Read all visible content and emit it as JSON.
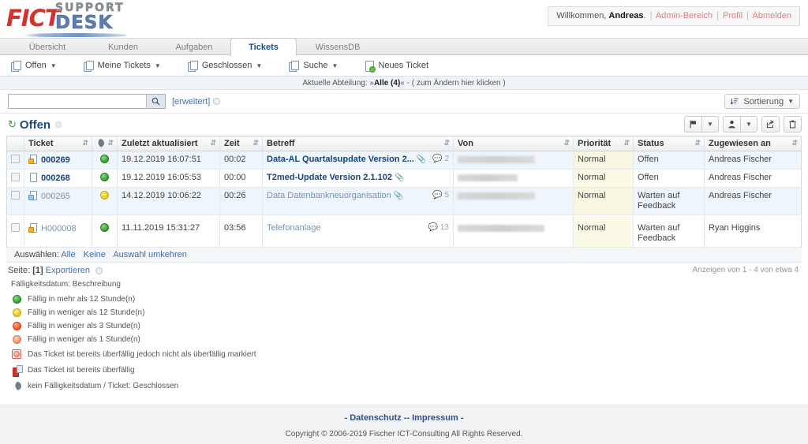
{
  "header": {
    "logo": {
      "part1": "FICT",
      "part2": "SUPPORT",
      "part3": "DESK"
    },
    "welcome_prefix": "Willkommen,",
    "welcome_user": "Andreas",
    "welcome_suffix": ".",
    "links": [
      "Admin-Bereich",
      "Profil",
      "Abmelden"
    ]
  },
  "tabs": [
    {
      "label": "Übersicht",
      "active": false
    },
    {
      "label": "Kunden",
      "active": false
    },
    {
      "label": "Aufgaben",
      "active": false
    },
    {
      "label": "Tickets",
      "active": true
    },
    {
      "label": "WissensDB",
      "active": false
    }
  ],
  "subnav": [
    {
      "label": "Offen",
      "icon": "pages-icon",
      "caret": true
    },
    {
      "label": "Meine Tickets",
      "icon": "pages-icon",
      "caret": true
    },
    {
      "label": "Geschlossen",
      "icon": "pages-icon",
      "caret": true
    },
    {
      "label": "Suche",
      "icon": "pages-icon",
      "caret": true
    },
    {
      "label": "Neues Ticket",
      "icon": "new-document-icon",
      "caret": false
    }
  ],
  "department_bar": {
    "label": "Aktuelle Abteilung:",
    "open_quote": "»",
    "value": "Alle (4)",
    "close_quote": "«",
    "dash": "-",
    "hint": "( zum Ändern hier klicken )"
  },
  "search": {
    "value": "",
    "placeholder": "",
    "advanced_label": "[erweitert]",
    "sort_label": "Sortierung"
  },
  "list": {
    "title": "Offen",
    "refresh_icon": "refresh-icon",
    "actions": [
      {
        "name": "flag-button",
        "icon": "flag-icon",
        "has_dropdown": true
      },
      {
        "name": "assign-user-button",
        "icon": "user-icon",
        "has_dropdown": true
      },
      {
        "name": "forward-button",
        "icon": "forward-icon",
        "has_dropdown": false
      },
      {
        "name": "delete-button",
        "icon": "trash-icon",
        "has_dropdown": false
      }
    ]
  },
  "table": {
    "columns": [
      {
        "label": "",
        "key": "checkbox",
        "sortable": false
      },
      {
        "label": "Ticket",
        "key": "ticket",
        "sortable": true
      },
      {
        "label": "",
        "key": "due",
        "sortable": true,
        "icon": "moon-icon"
      },
      {
        "label": "Zuletzt aktualisiert",
        "key": "updated",
        "sortable": true
      },
      {
        "label": "Zeit",
        "key": "time",
        "sortable": true
      },
      {
        "label": "Betreff",
        "key": "subject",
        "sortable": true
      },
      {
        "label": "Von",
        "key": "from",
        "sortable": true
      },
      {
        "label": "Priorität",
        "key": "priority",
        "sortable": true
      },
      {
        "label": "Status",
        "key": "status",
        "sortable": true
      },
      {
        "label": "Zugewiesen an",
        "key": "assigned",
        "sortable": true
      }
    ],
    "rows": [
      {
        "ticket": "000269",
        "ticket_icon": "ticket-locked-icon",
        "bold": true,
        "due_color": "green",
        "updated": "19.12.2019 16:07:51",
        "time": "00:02",
        "subject": "Data-AL Quartalsupdate Version 2...",
        "has_attachment": true,
        "comments": "2",
        "from_redacted_width": 98,
        "priority": "Normal",
        "status": "Offen",
        "assigned": "Andreas Fischer"
      },
      {
        "ticket": "000268",
        "ticket_icon": "ticket-document-icon",
        "bold": true,
        "due_color": "green",
        "updated": "19.12.2019 16:05:53",
        "time": "00:00",
        "subject": "T2med-Update Version 2.1.102",
        "has_attachment": true,
        "comments": "",
        "from_redacted_width": 76,
        "priority": "Normal",
        "status": "Offen",
        "assigned": "Andreas Fischer"
      },
      {
        "ticket": "000265",
        "ticket_icon": "ticket-draft-icon",
        "bold": false,
        "due_color": "yellow",
        "updated": "14.12.2019 10:06:22",
        "time": "00:26",
        "subject": "Data Datenbankneuorganisation",
        "has_attachment": true,
        "comments": "5",
        "from_redacted_width": 98,
        "priority": "Normal",
        "status": "Warten auf Feedback",
        "assigned": "Andreas Fischer"
      },
      {
        "ticket": "H000008",
        "ticket_icon": "ticket-locked-icon",
        "bold": false,
        "due_color": "green",
        "updated": "11.11.2019 15:31:27",
        "time": "03:56",
        "subject": "Telefonanlage",
        "has_attachment": false,
        "comments": "13",
        "from_redacted_width": 110,
        "priority": "Normal",
        "status": "Warten auf Feedback",
        "assigned": "Ryan Higgins"
      }
    ]
  },
  "selection": {
    "label": "Auswählen:",
    "options": [
      "Alle",
      "Keine",
      "Auswahl umkehren"
    ]
  },
  "pagination": {
    "page_label": "Seite:",
    "current_page": "[1]",
    "export_label": "Exportieren",
    "showing": "Anzeigen von  1 - 4 von etwa 4"
  },
  "legend": {
    "title": "Fälligkeitsdatum: Beschreibung",
    "items": [
      {
        "icon": "green-dot-icon",
        "text": "Fällig in mehr als 12 Stunde(n)"
      },
      {
        "icon": "yellow-dot-icon",
        "text": "Fällig in weniger als 12 Stunde(n)"
      },
      {
        "icon": "orange-dot-icon",
        "text": "Fällig in weniger als 3 Stunde(n)"
      },
      {
        "icon": "light-orange-dot-icon",
        "text": "Fällig in weniger als 1 Stunde(n)"
      },
      {
        "icon": "boxed-overdue-icon",
        "text": "Das Ticket ist bereits überfällig jedoch nicht als überfällig markiert"
      },
      {
        "icon": "fire-extinguisher-icon",
        "text": "Das Ticket ist bereits überfällig"
      },
      {
        "icon": "moon-icon",
        "text": "kein Fälligkeitsdatum / Ticket: Geschlossen"
      }
    ]
  },
  "footer": {
    "prefix": "-",
    "link1": "Datenschutz",
    "middle": "--",
    "link2": "Impressum",
    "suffix": "-",
    "copyright": "Copyright © 2006-2019 Fischer ICT-Consulting All Rights Reserved."
  },
  "colors": {
    "brand_red": "#d0342c",
    "brand_blue": "#5b7db1",
    "link": "#3f6fae",
    "title": "#1b4b85",
    "row_alt": "#eef5fb",
    "priority_bg": "#fbfae6"
  }
}
